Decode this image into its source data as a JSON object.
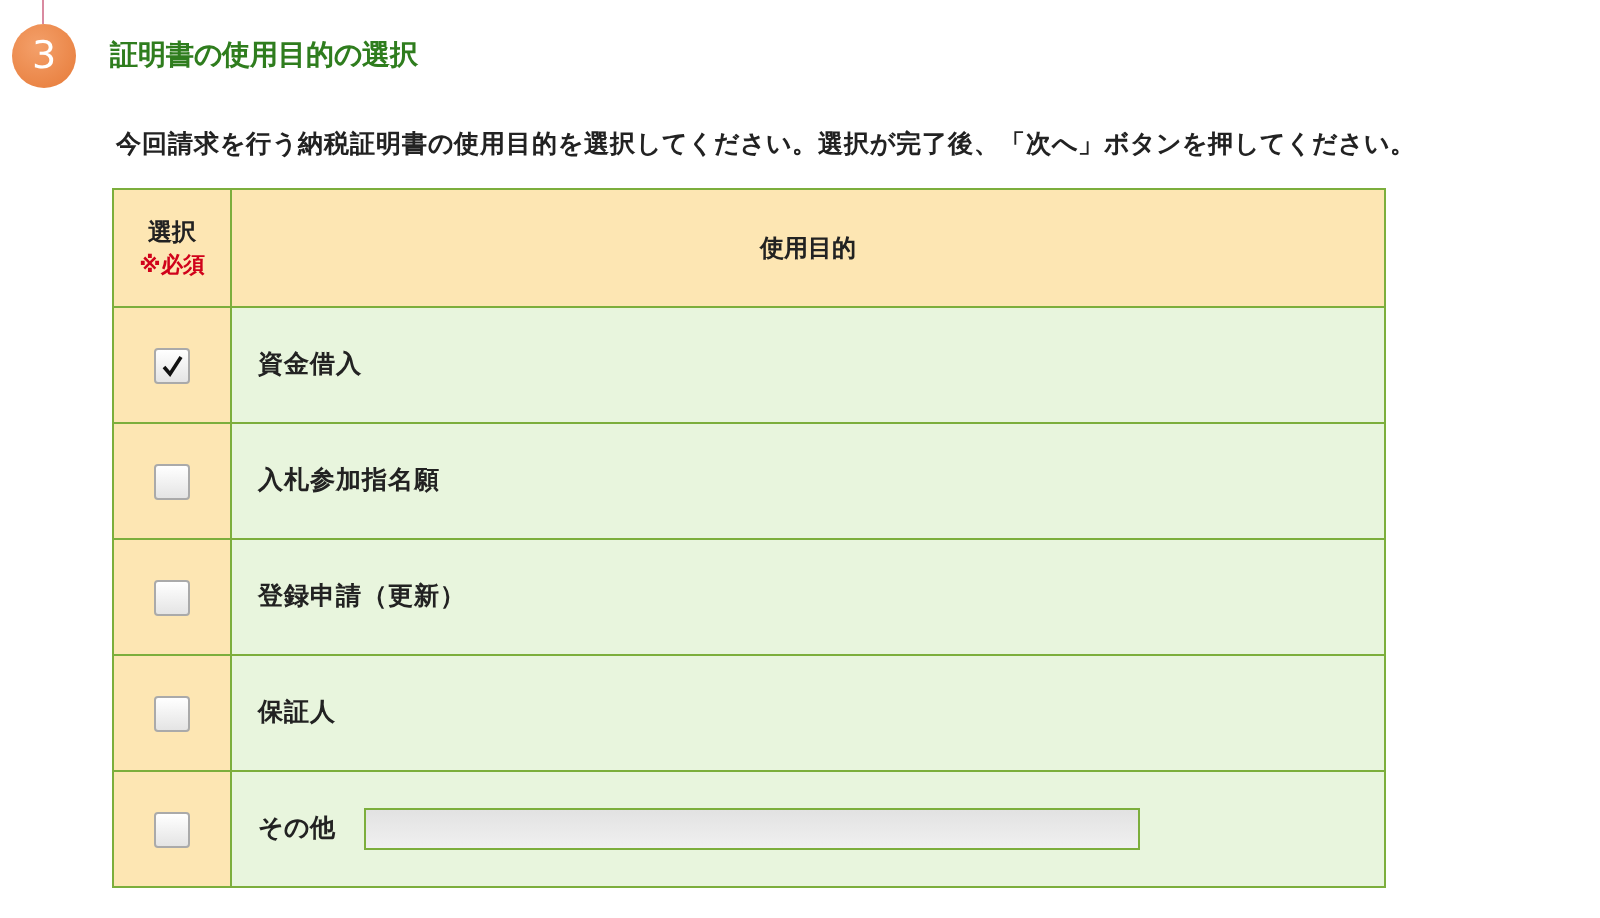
{
  "step": {
    "number": "3",
    "title": "証明書の使用目的の選択"
  },
  "instructions": "今回請求を行う納税証明書の使用目的を選択してください。選択が完了後、「次へ」ボタンを押してください。",
  "table": {
    "columns": [
      {
        "label": "選択",
        "note": "※必須"
      },
      {
        "label": "使用目的"
      }
    ],
    "rows": [
      {
        "kind": "option",
        "label": "資金借入",
        "checked": true
      },
      {
        "kind": "option",
        "label": "入札参加指名願",
        "checked": false
      },
      {
        "kind": "option",
        "label": "登録申請（更新）",
        "checked": false
      },
      {
        "kind": "option",
        "label": "保証人",
        "checked": false
      },
      {
        "kind": "other",
        "label": "その他",
        "checked": false
      }
    ]
  }
}
